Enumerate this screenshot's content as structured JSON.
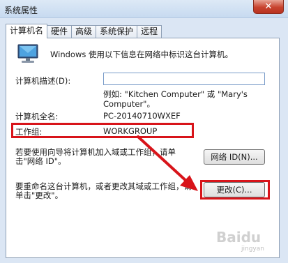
{
  "window": {
    "title": "系统属性",
    "close_label": "✕"
  },
  "tabs": [
    {
      "label": "计算机名",
      "active": true
    },
    {
      "label": "硬件",
      "active": false
    },
    {
      "label": "高级",
      "active": false
    },
    {
      "label": "系统保护",
      "active": false
    },
    {
      "label": "远程",
      "active": false
    }
  ],
  "main": {
    "intro": "Windows 使用以下信息在网络中标识这台计算机。",
    "description_label": "计算机描述(D):",
    "description_value": "",
    "example_text": "例如: \"Kitchen Computer\" 或 \"Mary's Computer\"。",
    "full_name_label": "计算机全名:",
    "full_name_value": "PC-20140710WXEF",
    "workgroup_label": "工作组:",
    "workgroup_value": "WORKGROUP",
    "network_id_text": "若要使用向导将计算机加入域或工作组，请单击\"网络 ID\"。",
    "network_id_button": "网络 ID(N)...",
    "rename_text": "要重命名这台计算机，或者更改其域或工作组，请单击\"更改\"。",
    "change_button": "更改(C)..."
  },
  "colors": {
    "highlight": "#d8141a"
  }
}
